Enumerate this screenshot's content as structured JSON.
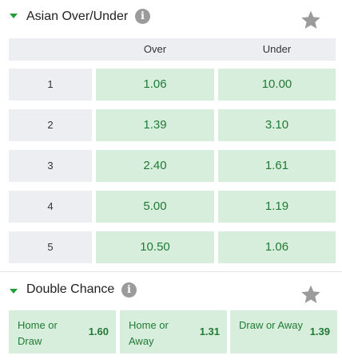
{
  "asian_over_under": {
    "title": "Asian Over/Under",
    "info_icon": "info-icon",
    "favorite_icon": "star-icon",
    "columns": [
      "",
      "Over",
      "Under"
    ],
    "rows": [
      {
        "line": "1",
        "over": "1.06",
        "under": "10.00"
      },
      {
        "line": "2",
        "over": "1.39",
        "under": "3.10"
      },
      {
        "line": "3",
        "over": "2.40",
        "under": "1.61"
      },
      {
        "line": "4",
        "over": "5.00",
        "under": "1.19"
      },
      {
        "line": "5",
        "over": "10.50",
        "under": "1.06"
      }
    ]
  },
  "double_chance": {
    "title": "Double Chance",
    "info_icon": "info-icon",
    "favorite_icon": "star-icon",
    "options": [
      {
        "label": "Home or Draw",
        "odd": "1.60"
      },
      {
        "label": "Home or Away",
        "odd": "1.31"
      },
      {
        "label": "Draw or Away",
        "odd": "1.39"
      }
    ]
  },
  "colors": {
    "accent_green": "#1f9e3a",
    "odd_bg": "#d8eedd",
    "odd_text": "#217a34",
    "header_bg": "#eceef1",
    "icon_grey": "#9b9b9b"
  }
}
